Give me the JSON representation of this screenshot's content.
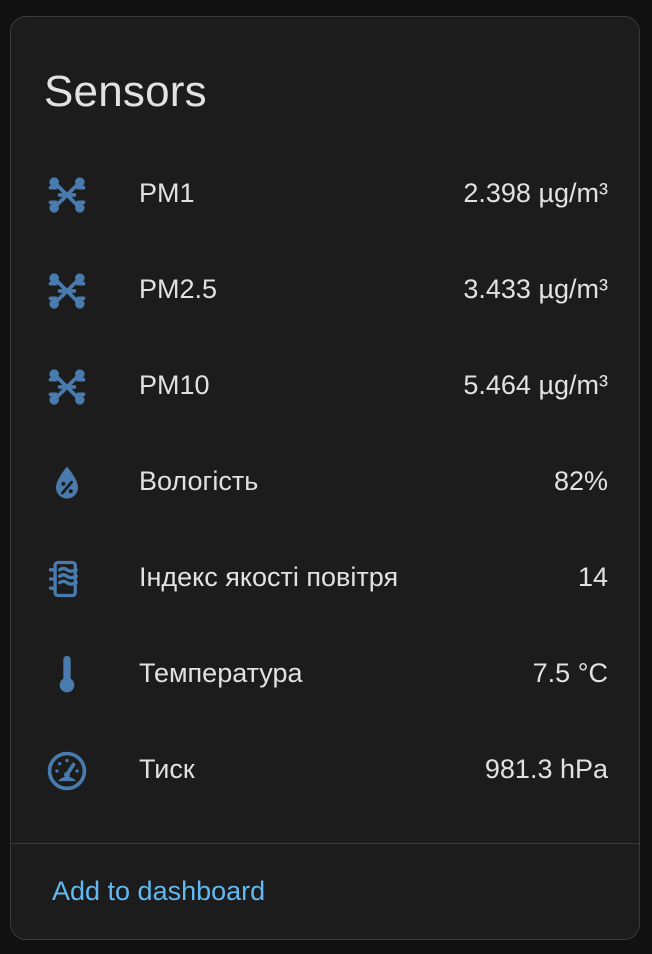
{
  "card": {
    "title": "Sensors",
    "icon_color": "#4a7bae",
    "text_color": "#e1e1e1",
    "link_color": "#61b9f2"
  },
  "sensors": [
    {
      "icon": "molecule-icon",
      "label": "PM1",
      "value": "2.398 µg/m³"
    },
    {
      "icon": "molecule-icon",
      "label": "PM2.5",
      "value": "3.433 µg/m³"
    },
    {
      "icon": "molecule-icon",
      "label": "PM10",
      "value": "5.464 µg/m³"
    },
    {
      "icon": "water-percent-icon",
      "label": "Вологість",
      "value": "82%"
    },
    {
      "icon": "air-filter-icon",
      "label": "Індекс якості повітря",
      "value": "14"
    },
    {
      "icon": "thermometer-icon",
      "label": "Температура",
      "value": "7.5 °C"
    },
    {
      "icon": "gauge-icon",
      "label": "Тиск",
      "value": "981.3 hPa"
    }
  ],
  "footer": {
    "add_to_dashboard_label": "Add to dashboard"
  }
}
